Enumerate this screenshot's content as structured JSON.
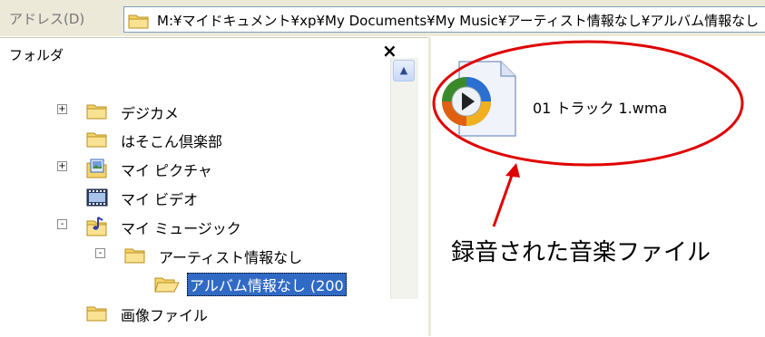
{
  "address_bar": {
    "label": "アドレス(D)",
    "path": "M:¥マイドキュメント¥xp¥My Documents¥My Music¥アーティスト情報なし¥アルバム情報なし"
  },
  "folder_pane": {
    "title": "フォルダ",
    "close": "×",
    "scroll_up": "▲",
    "items": [
      {
        "label": "デジカメ",
        "expander": "+"
      },
      {
        "label": "はそこん倶楽部"
      },
      {
        "label": "マイ ピクチャ",
        "expander": "+"
      },
      {
        "label": "マイ ビデオ"
      },
      {
        "label": "マイ ミュージック",
        "expander": "-"
      },
      {
        "label": "アーティスト情報なし",
        "expander": "-"
      },
      {
        "label": "アルバム情報なし (200",
        "selected": true
      },
      {
        "label": "画像ファイル"
      }
    ]
  },
  "file_view": {
    "files": [
      {
        "name": "01 トラック 1.wma",
        "icon": "windows-media-audio-icon"
      }
    ]
  },
  "annotation": {
    "text": "録音された音楽ファイル",
    "color": "#e00000"
  },
  "colors": {
    "selection": "#316ac5",
    "folder": "#f4d46b",
    "chrome": "#ece9d8"
  }
}
